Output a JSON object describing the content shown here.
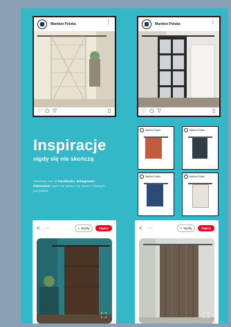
{
  "ig_posts": [
    {
      "account": "Mantion Polska",
      "menu_icon": "more-vertical-icon",
      "icons": [
        "heart-icon",
        "comment-icon",
        "send-icon",
        "bookmark-icon"
      ]
    },
    {
      "account": "Mantion Polska",
      "menu_icon": "more-vertical-icon",
      "icons": [
        "heart-icon",
        "comment-icon",
        "send-icon",
        "bookmark-icon"
      ]
    }
  ],
  "mini_posts": [
    {
      "account": "Mantion Polska",
      "door_color": "#c25a3e"
    },
    {
      "account": "Mantion Polska",
      "door_color": "#2f3d45"
    },
    {
      "account": "Mantion Polska",
      "door_color": "#2b4a75"
    },
    {
      "account": "Mantion Polska",
      "door_color": "#e8e4dc"
    }
  ],
  "headline": "Inspiracje",
  "subhead": "nigdy się nie skończą",
  "paragraph": {
    "pre": "Obserwuj nas na ",
    "facebook": "Facebooku",
    "sep1": ", ",
    "instagram": "Instagramie",
    "sep2": " i ",
    "pinterest": "Pintereście",
    "post": ". Nach nie ominie Cię żaden z naszych pomysłów!"
  },
  "pins": [
    {
      "back": "<",
      "more": "···",
      "share_label": "Wyślij",
      "save_label": "Zapisz"
    },
    {
      "back": "<",
      "more": "···",
      "share_label": "Wyślij",
      "save_label": "Zapisz"
    }
  ],
  "colors": {
    "background": "#8aa0b5",
    "panel": "#34b8c7",
    "pinterest_red": "#e60023"
  }
}
